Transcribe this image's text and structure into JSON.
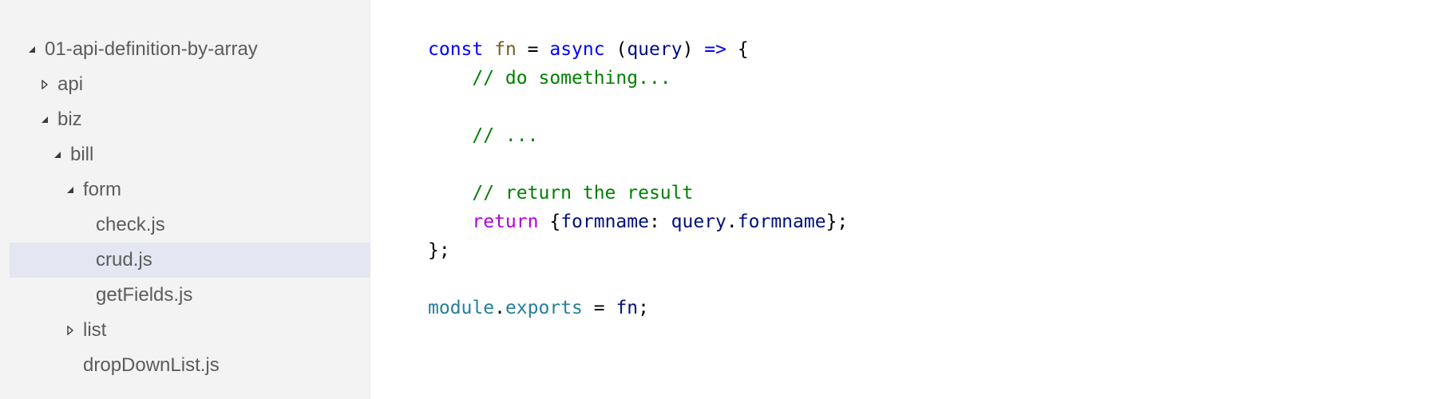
{
  "theme": {
    "sidebar_bg": "#f3f3f3",
    "selected_bg": "#e4e6f1",
    "editor_bg": "#ffffff",
    "keyword_color": "#0000ff",
    "comment_color": "#008000",
    "control_color": "#af00db",
    "function_color": "#795e26",
    "variable_color": "#001080",
    "type_color": "#267f99"
  },
  "explorer": {
    "items": [
      {
        "label": "01-api-definition-by-array",
        "depth": 0,
        "twisty": "expanded",
        "selected": false,
        "name": "folder-01-api-definition-by-array"
      },
      {
        "label": "api",
        "depth": 1,
        "twisty": "collapsed",
        "selected": false,
        "name": "folder-api"
      },
      {
        "label": "biz",
        "depth": 1,
        "twisty": "expanded",
        "selected": false,
        "name": "folder-biz"
      },
      {
        "label": "bill",
        "depth": 2,
        "twisty": "expanded",
        "selected": false,
        "name": "folder-bill"
      },
      {
        "label": "form",
        "depth": 3,
        "twisty": "expanded",
        "selected": false,
        "name": "folder-form"
      },
      {
        "label": "check.js",
        "depth": 4,
        "twisty": "none",
        "selected": false,
        "name": "file-check-js"
      },
      {
        "label": "crud.js",
        "depth": 4,
        "twisty": "none",
        "selected": true,
        "name": "file-crud-js"
      },
      {
        "label": "getFields.js",
        "depth": 4,
        "twisty": "none",
        "selected": false,
        "name": "file-getfields-js"
      },
      {
        "label": "list",
        "depth": 3,
        "twisty": "collapsed",
        "selected": false,
        "name": "folder-list"
      },
      {
        "label": "dropDownList.js",
        "depth": 3,
        "twisty": "none",
        "selected": false,
        "name": "file-dropdownlist-js"
      }
    ]
  },
  "editor": {
    "lines": [
      [
        {
          "t": "kw",
          "v": "const"
        },
        {
          "t": "plain",
          "v": " "
        },
        {
          "t": "fn",
          "v": "fn"
        },
        {
          "t": "plain",
          "v": " = "
        },
        {
          "t": "kw",
          "v": "async"
        },
        {
          "t": "plain",
          "v": " ("
        },
        {
          "t": "param",
          "v": "query"
        },
        {
          "t": "plain",
          "v": ") "
        },
        {
          "t": "kw",
          "v": "=>"
        },
        {
          "t": "plain",
          "v": " {"
        }
      ],
      [
        {
          "t": "plain",
          "v": "    "
        },
        {
          "t": "comment",
          "v": "// do something..."
        }
      ],
      [],
      [
        {
          "t": "plain",
          "v": "    "
        },
        {
          "t": "comment",
          "v": "// ..."
        }
      ],
      [],
      [
        {
          "t": "plain",
          "v": "    "
        },
        {
          "t": "comment",
          "v": "// return the result"
        }
      ],
      [
        {
          "t": "plain",
          "v": "    "
        },
        {
          "t": "ctrl",
          "v": "return"
        },
        {
          "t": "plain",
          "v": " {"
        },
        {
          "t": "param",
          "v": "formname"
        },
        {
          "t": "plain",
          "v": ": "
        },
        {
          "t": "param",
          "v": "query"
        },
        {
          "t": "plain",
          "v": "."
        },
        {
          "t": "param",
          "v": "formname"
        },
        {
          "t": "plain",
          "v": "};"
        }
      ],
      [
        {
          "t": "plain",
          "v": "};"
        }
      ],
      [],
      [
        {
          "t": "module",
          "v": "module"
        },
        {
          "t": "plain",
          "v": "."
        },
        {
          "t": "module",
          "v": "exports"
        },
        {
          "t": "plain",
          "v": " = "
        },
        {
          "t": "param",
          "v": "fn"
        },
        {
          "t": "plain",
          "v": ";"
        }
      ]
    ]
  }
}
